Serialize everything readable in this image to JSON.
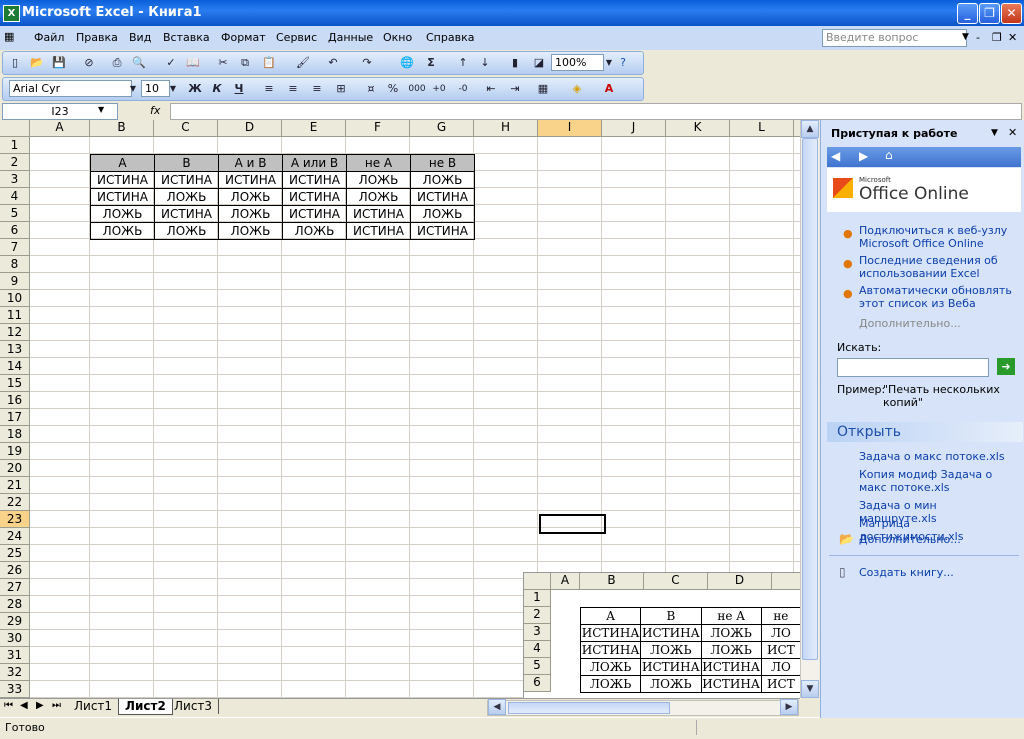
{
  "window": {
    "title": "Microsoft Excel - Книга1",
    "logo": "X"
  },
  "menubar": {
    "items": [
      "Файл",
      "Правка",
      "Вид",
      "Вставка",
      "Формат",
      "Сервис",
      "Данные",
      "Окно",
      "Справка"
    ],
    "ask_placeholder": "Введите вопрос"
  },
  "toolbar": {
    "zoom": "100%",
    "font": "Arial Cyr",
    "size": "10",
    "bold": "Ж",
    "italic": "К",
    "underline": "Ч",
    "percent": "%",
    "thousands": "000"
  },
  "formula": {
    "namebox": "I23",
    "fx": "fx"
  },
  "sheet": {
    "columns": [
      "A",
      "B",
      "C",
      "D",
      "E",
      "F",
      "G",
      "H",
      "I",
      "J",
      "K",
      "L"
    ],
    "selected_col": "I",
    "selected_row": "23",
    "rows": [
      "1",
      "2",
      "3",
      "4",
      "5",
      "6",
      "7",
      "8",
      "9",
      "10",
      "11",
      "12",
      "13",
      "14",
      "15",
      "16",
      "17",
      "18",
      "19",
      "20",
      "21",
      "22",
      "23",
      "24",
      "25",
      "26",
      "27",
      "28",
      "29",
      "30",
      "31",
      "32",
      "33"
    ],
    "table_header": [
      "A",
      "B",
      "A и B",
      "A или B",
      "не A",
      "не B"
    ],
    "table_rows": [
      [
        "ИСТИНА",
        "ИСТИНА",
        "ИСТИНА",
        "ИСТИНА",
        "ЛОЖЬ",
        "ЛОЖЬ"
      ],
      [
        "ИСТИНА",
        "ЛОЖЬ",
        "ЛОЖЬ",
        "ИСТИНА",
        "ЛОЖЬ",
        "ИСТИНА"
      ],
      [
        "ЛОЖЬ",
        "ИСТИНА",
        "ЛОЖЬ",
        "ИСТИНА",
        "ИСТИНА",
        "ЛОЖЬ"
      ],
      [
        "ЛОЖЬ",
        "ЛОЖЬ",
        "ЛОЖЬ",
        "ЛОЖЬ",
        "ИСТИНА",
        "ИСТИНА"
      ]
    ]
  },
  "embedded": {
    "columns": [
      "A",
      "B",
      "C",
      "D",
      "E"
    ],
    "rows": [
      "1",
      "2",
      "3",
      "4",
      "5",
      "6"
    ],
    "header": [
      "A",
      "B",
      "не A",
      "не"
    ],
    "data": [
      [
        "ИСТИНА",
        "ИСТИНА",
        "ЛОЖЬ",
        "ЛО"
      ],
      [
        "ИСТИНА",
        "ЛОЖЬ",
        "ЛОЖЬ",
        "ИСТ"
      ],
      [
        "ЛОЖЬ",
        "ИСТИНА",
        "ИСТИНА",
        "ЛО"
      ],
      [
        "ЛОЖЬ",
        "ЛОЖЬ",
        "ИСТИНА",
        "ИСТ"
      ]
    ]
  },
  "tabs": [
    "Лист1",
    "Лист2",
    "Лист3"
  ],
  "active_tab": "Лист2",
  "status": {
    "text": "Готово"
  },
  "taskpane": {
    "title": "Приступая к работе",
    "office_small": "Microsoft",
    "office_brand": "Office Online",
    "links": [
      "Подключиться к веб-узлу Microsoft Office Online",
      "Последние сведения об использовании Excel",
      "Автоматически обновлять этот список из Веба"
    ],
    "more": "Дополнительно...",
    "search_label": "Искать:",
    "example_label": "Пример:",
    "example_text": "\"Печать нескольких копий\"",
    "open_title": "Открыть",
    "files": [
      "Задача о макс потоке.xls",
      "Копия модиф Задача о макс потоке.xls",
      "Задача о мин маршруте.xls",
      "Матрица достижимости.xls"
    ],
    "open_more": "Дополнительно...",
    "new_book": "Создать книгу..."
  }
}
